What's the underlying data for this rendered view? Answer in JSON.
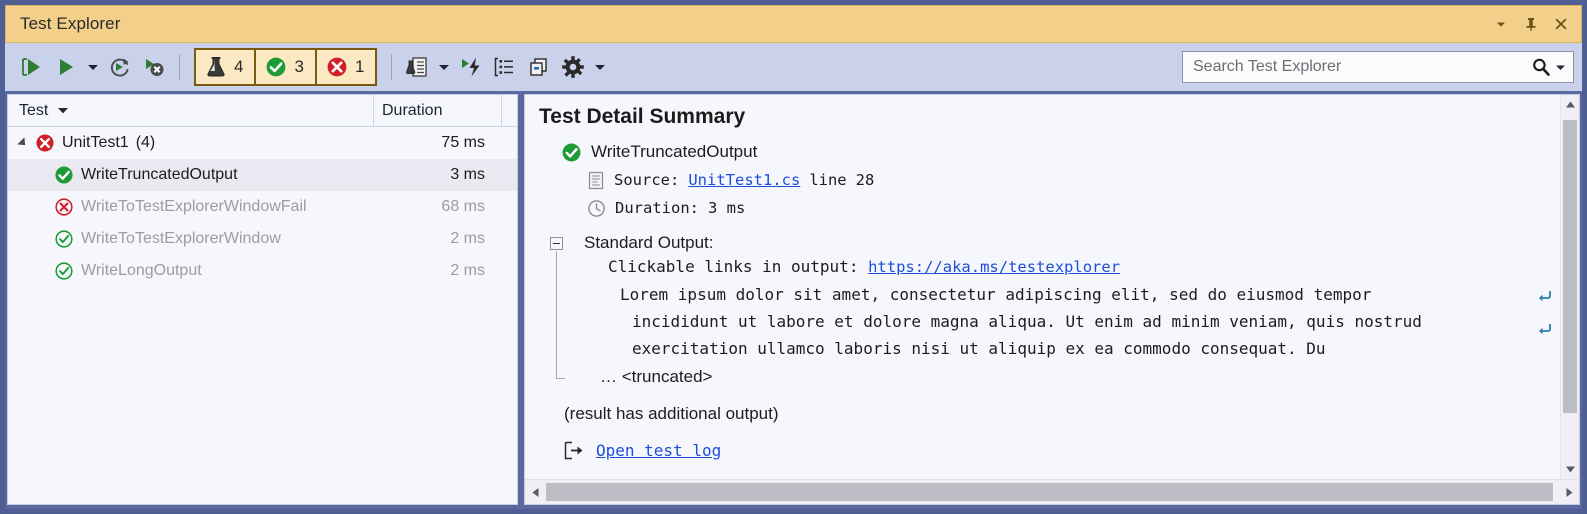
{
  "window": {
    "title": "Test Explorer",
    "title_buttons": [
      {
        "name": "window-dropdown",
        "icon": "chevron-down-icon"
      },
      {
        "name": "pin",
        "icon": "pin-icon"
      },
      {
        "name": "close",
        "icon": "close-icon"
      }
    ]
  },
  "toolbar": {
    "buttons": [
      {
        "name": "run-all-tests",
        "icon": "run-all-icon"
      },
      {
        "name": "run",
        "icon": "play-icon"
      },
      {
        "name": "run-dropdown",
        "icon": "caret-down-icon"
      },
      {
        "name": "repeat-last-run",
        "icon": "repeat-run-icon"
      },
      {
        "name": "cancel-run",
        "icon": "stop-run-icon"
      }
    ],
    "counters": [
      {
        "name": "total-tests",
        "icon": "flask-icon",
        "count": "4"
      },
      {
        "name": "passed-tests",
        "icon": "passed-icon",
        "count": "3"
      },
      {
        "name": "failed-tests",
        "icon": "failed-icon",
        "count": "1"
      }
    ],
    "right_buttons": [
      {
        "name": "test-results-document",
        "icon": "test-document-icon"
      },
      {
        "name": "test-results-dropdown",
        "icon": "caret-down-icon"
      },
      {
        "name": "run-with-profiler",
        "icon": "lightning-icon"
      },
      {
        "name": "group-by",
        "icon": "group-list-icon"
      },
      {
        "name": "copy-results",
        "icon": "copy-icon"
      },
      {
        "name": "settings",
        "icon": "gear-icon"
      },
      {
        "name": "settings-dropdown",
        "icon": "caret-down-icon"
      }
    ]
  },
  "search": {
    "placeholder": "Search Test Explorer",
    "value": "",
    "icon": "search-icon",
    "dropdown_icon": "caret-down-icon"
  },
  "test_list": {
    "columns": [
      {
        "label": "Test",
        "sort_icon": "sort-desc-icon"
      },
      {
        "label": "Duration"
      }
    ],
    "rows": [
      {
        "name": "UnitTest1",
        "suffix": "(4)",
        "duration": "75 ms",
        "status": "failed",
        "level": "group",
        "expanded": true,
        "selected": false
      },
      {
        "name": "WriteTruncatedOutput",
        "suffix": "",
        "duration": "3 ms",
        "status": "passed",
        "level": "child",
        "selected": true
      },
      {
        "name": "WriteToTestExplorerWindowFail",
        "suffix": "",
        "duration": "68 ms",
        "status": "failed",
        "level": "child",
        "selected": false
      },
      {
        "name": "WriteToTestExplorerWindow",
        "suffix": "",
        "duration": "2 ms",
        "status": "passed-dim",
        "level": "child",
        "selected": false
      },
      {
        "name": "WriteLongOutput",
        "suffix": "",
        "duration": "2 ms",
        "status": "passed-dim",
        "level": "child",
        "selected": false
      }
    ]
  },
  "detail": {
    "heading": "Test Detail Summary",
    "test_name": "WriteTruncatedOutput",
    "test_status_icon": "passed-icon",
    "source_label": "Source:",
    "source_link": "UnitTest1.cs",
    "source_line_label": "line",
    "source_line": "28",
    "source_icon": "source-file-icon",
    "duration_label": "Duration:",
    "duration_value": "3 ms",
    "duration_icon": "clock-icon",
    "stdout_label": "Standard Output:",
    "output_lines": [
      "Clickable links in output: ",
      "Lorem ipsum dolor sit amet, consectetur adipiscing elit, sed do eiusmod tempor",
      "incididunt ut labore et dolore magna aliqua. Ut enim ad minim veniam, quis nostrud",
      "exercitation ullamco laboris nisi ut aliquip ex ea commodo consequat. Du"
    ],
    "output_link": "https://aka.ms/testexplorer",
    "truncated_text": "… <truncated>",
    "additional_output_note": "(result has additional output)",
    "open_log_link": "Open test log",
    "open_log_icon": "open-external-icon",
    "wrap_markers": [
      "wrap-arrow-icon",
      "wrap-arrow-icon"
    ]
  },
  "scrollbars": {
    "vertical": {
      "up_icon": "caret-up-icon",
      "down_icon": "caret-down-icon"
    },
    "horizontal": {
      "left_icon": "caret-left-icon",
      "right_icon": "caret-right-icon"
    }
  },
  "colors": {
    "title_bar": "#f2d08a",
    "toolbar": "#c9d2ea",
    "frame": "#5a6a9e",
    "pass_green": "#1f9b35",
    "fail_red": "#d01f28",
    "link_blue": "#1c4fd8",
    "counter_panel": "#fbe9c3",
    "counter_border": "#7a5a12",
    "selection": "#e9eaf1"
  }
}
